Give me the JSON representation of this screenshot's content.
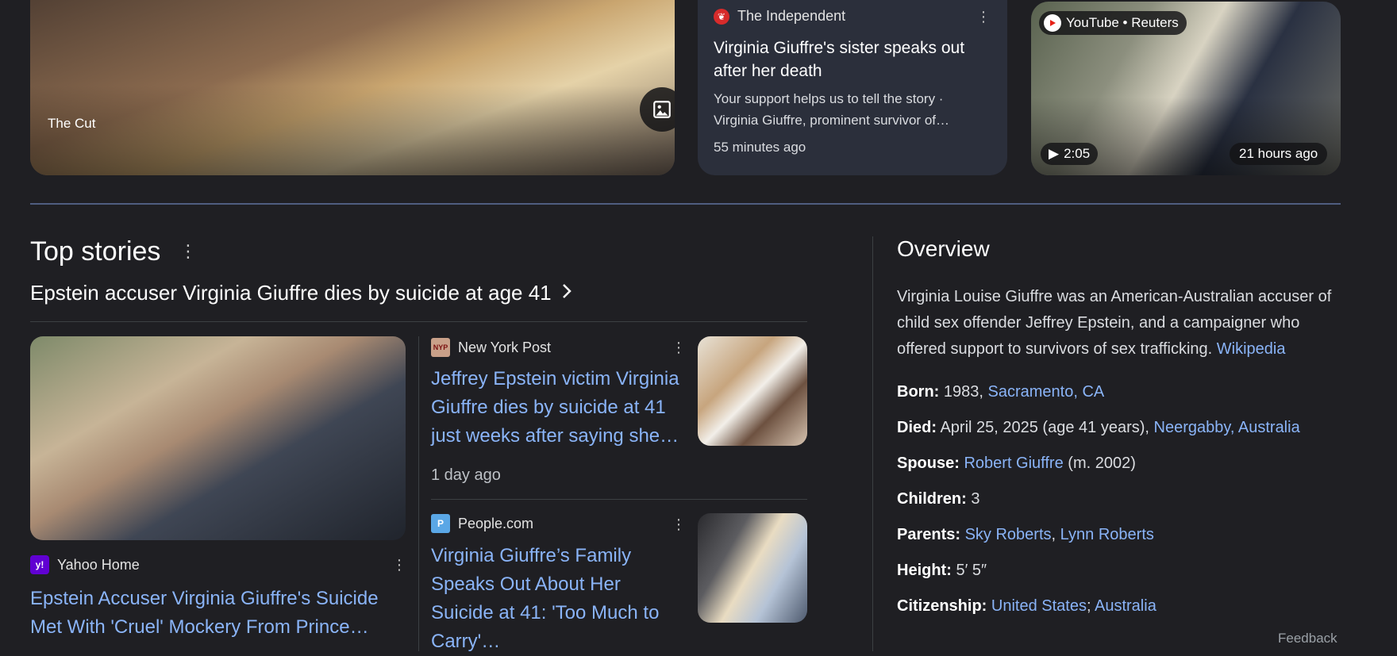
{
  "top_row": {
    "cut_card": {
      "source": "The Cut"
    },
    "independent_card": {
      "publisher": "The Independent",
      "title": "Virginia Giuffre's sister speaks out after her death",
      "snippet": "Your support helps us to tell the story · Virginia Giuffre, prominent survivor of…",
      "time": "55 minutes ago"
    },
    "video_card": {
      "source": "YouTube • Reuters",
      "duration": "2:05",
      "time": "21 hours ago"
    }
  },
  "top_stories": {
    "heading": "Top stories",
    "subheading": "Epstein accuser Virginia Giuffre dies by suicide at age 41",
    "main_story": {
      "publisher": "Yahoo Home",
      "title": "Epstein Accuser Virginia Giuffre's Suicide Met With 'Cruel' Mockery From Prince…"
    },
    "story_1": {
      "publisher": "New York Post",
      "title": "Jeffrey Epstein victim Virginia Giuffre dies by suicide at 41 just weeks after saying she…",
      "time": "1 day ago"
    },
    "story_2": {
      "publisher": "People.com",
      "title": "Virginia Giuffre’s Family Speaks Out About Her Suicide at 41: 'Too Much to Carry'…"
    }
  },
  "overview": {
    "heading": "Overview",
    "description": "Virginia Louise Giuffre was an American-Australian accuser of child sex offender Jeffrey Epstein, and a campaigner who offered support to survivors of sex trafficking.",
    "source_link": "Wikipedia",
    "born_label": "Born:",
    "born_value": "1983,",
    "born_place": "Sacramento, CA",
    "died_label": "Died:",
    "died_value": "April 25, 2025 (age 41 years),",
    "died_place": "Neergabby, Australia",
    "spouse_label": "Spouse:",
    "spouse_name": "Robert Giuffre",
    "spouse_extra": "(m. 2002)",
    "children_label": "Children:",
    "children_value": "3",
    "parents_label": "Parents:",
    "parent_1": "Sky Roberts",
    "parents_sep": ",",
    "parent_2": "Lynn Roberts",
    "height_label": "Height:",
    "height_value": "5′ 5″",
    "citizenship_label": "Citizenship:",
    "citizenship_1": "United States",
    "citizenship_sep": ";",
    "citizenship_2": "Australia",
    "feedback": "Feedback"
  },
  "colors": {
    "background": "#1f1f23",
    "link": "#8ab4f8",
    "card": "#2b2f3b",
    "divider": "#4f5d80"
  }
}
